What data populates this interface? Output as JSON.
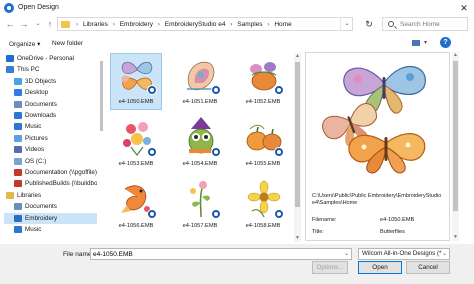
{
  "window": {
    "title": "Open Design"
  },
  "address": {
    "crumbs": [
      "Libraries",
      "Embroidery",
      "EmbroideryStudio e4",
      "Samples",
      "Home"
    ],
    "separator": "›"
  },
  "search": {
    "placeholder": "Search Home"
  },
  "toolbar": {
    "organize": "Organize ▾",
    "new_folder": "New folder"
  },
  "nav": {
    "items": [
      {
        "label": "OneDrive - Personal",
        "icon": "cloud-icon",
        "color": "#1f6fd1"
      },
      {
        "label": "This PC",
        "icon": "computer-icon",
        "color": "#3a7bd5"
      },
      {
        "label": "3D Objects",
        "icon": "cube-icon",
        "color": "#49a3e8"
      },
      {
        "label": "Desktop",
        "icon": "desktop-icon",
        "color": "#2f7de1"
      },
      {
        "label": "Documents",
        "icon": "document-icon",
        "color": "#6c8ebf"
      },
      {
        "label": "Downloads",
        "icon": "download-icon",
        "color": "#2a78d4"
      },
      {
        "label": "Music",
        "icon": "music-icon",
        "color": "#2a78d4"
      },
      {
        "label": "Pictures",
        "icon": "picture-icon",
        "color": "#5aa0e6"
      },
      {
        "label": "Videos",
        "icon": "video-icon",
        "color": "#5a6ab0"
      },
      {
        "label": "OS (C:)",
        "icon": "drive-icon",
        "color": "#7aa2cc"
      },
      {
        "label": "Documentation (\\\\pgoffile)",
        "icon": "network-drive-icon",
        "color": "#c0392b"
      },
      {
        "label": "PublishedBuilds (\\\\buildbo",
        "icon": "network-drive-icon",
        "color": "#c0392b"
      },
      {
        "label": "Libraries",
        "icon": "libraries-icon",
        "color": "#e6b84a"
      },
      {
        "label": "Documents",
        "icon": "document-icon",
        "color": "#6c8ebf"
      },
      {
        "label": "Embroidery",
        "icon": "embroidery-library-icon",
        "color": "#2f6cc0"
      },
      {
        "label": "Music",
        "icon": "music-icon",
        "color": "#2a78d4"
      }
    ],
    "selected_index": 14
  },
  "files": [
    {
      "name": "e4-1050.EMB",
      "art": "butterflies"
    },
    {
      "name": "e4-1051.EMB",
      "art": "seashell"
    },
    {
      "name": "e4-1052.EMB",
      "art": "pumpkins-floral"
    },
    {
      "name": "e4-1053.EMB",
      "art": "flower-bouquet"
    },
    {
      "name": "e4-1054.EMB",
      "art": "owl-witch"
    },
    {
      "name": "e4-1055.EMB",
      "art": "pumpkins"
    },
    {
      "name": "e4-1056.EMB",
      "art": "koi-fish"
    },
    {
      "name": "e4-1057.EMB",
      "art": "flower-sprig"
    },
    {
      "name": "e4-1058.EMB",
      "art": "yellow-flower"
    }
  ],
  "selected_file_index": 0,
  "preview": {
    "path": "C:\\Users\\Public\\Public Embroidery\\EmbroideryStudio e4\\Samples\\Home",
    "filename_label": "Filename:",
    "filename_value": "e4-1050.EMB",
    "title_label": "Title:",
    "title_value": "Butterflies"
  },
  "bottom": {
    "filename_label": "File name:",
    "filename_value": "e4-1050.EMB",
    "type_value": "Wilcom All-in-One Designs (*.E",
    "options_label": "Options...",
    "open_label": "Open",
    "cancel_label": "Cancel"
  },
  "colors": {
    "selection": "#cce4f7",
    "accent": "#0078d7"
  }
}
